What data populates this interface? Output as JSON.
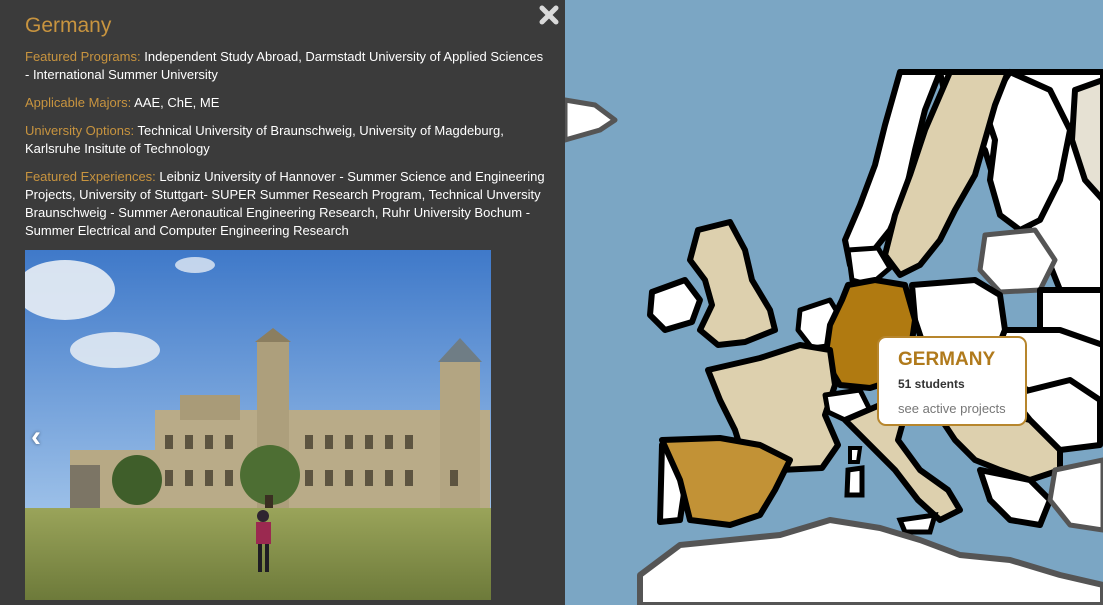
{
  "panel": {
    "title": "Germany",
    "featured_programs": {
      "label": "Featured Programs:",
      "value": "Independent Study Abroad, Darmstadt University of Applied Sciences - International Summer University"
    },
    "applicable_majors": {
      "label": "Applicable Majors:",
      "value": "AAE, ChE, ME"
    },
    "university_options": {
      "label": "University Options:",
      "value": "Technical University of Braunschweig, University of Magdeburg, Karlsruhe Insitute of Technology"
    },
    "featured_experiences": {
      "label": "Featured Experiences:",
      "value": "Leibniz University of Hannover - Summer Science and Engineering Projects, University of Stuttgart- SUPER Summer Research Program, Technical Unversity Braunschweig - Summer Aeronautical Engineering Research, Ruhr University Bochum - Summer Electrical and Computer Engineering Research"
    },
    "close_icon": "close-x-icon",
    "prev_icon": "chevron-left-icon",
    "next_icon": "chevron-right-icon"
  },
  "tooltip": {
    "country": "GERMANY",
    "students": "51 students",
    "link": "see active projects"
  },
  "colors": {
    "panel_bg": "#3b3b3b",
    "accent": "#c8943f",
    "sea": "#7ba6c4",
    "land_light": "#ddd0ae",
    "land_white": "#ffffff",
    "germany": "#b07a11",
    "spain": "#c29236",
    "border": "#000000"
  }
}
